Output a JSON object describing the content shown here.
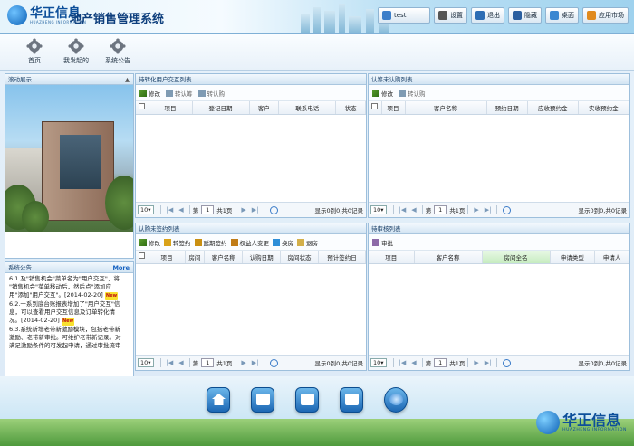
{
  "header": {
    "logo_cn": "华正信息",
    "logo_en": "HUAZHENG INFORMATION",
    "title": "地产销售管理系统",
    "buttons": [
      {
        "label": "test",
        "icon": "user-icon"
      },
      {
        "label": "设置",
        "icon": "settings-icon"
      },
      {
        "label": "退出",
        "icon": "logout-icon"
      },
      {
        "label": "隐藏",
        "icon": "hide-icon"
      },
      {
        "label": "桌面",
        "icon": "desktop-icon"
      },
      {
        "label": "应用市场",
        "icon": "app-market-icon"
      }
    ]
  },
  "topnav": [
    "首页",
    "我发起的",
    "系统公告"
  ],
  "left": {
    "photo_title": "滚动展示",
    "ann_title": "系统公告",
    "ann_more": "More",
    "ann_lines": [
      "6.1.及\"销售机会\"菜单名为\"用户交互\"，将",
      "\"销售机会\"菜单移动后，然后点\"添加应",
      "用\"添加\"用户交互\"。[2014-02-20]",
      "6.2.一系到底台账报表增加了\"用户交互\"信",
      "息，可以查看用户交互信息及订单转化情",
      "况。[2014-02-20]",
      "6.3.系统新增老带新激励模块，包括老带新",
      "激励、老带新审批。可维护老带新记录。对",
      "满足激励条件的可发起申请，通过审批流审"
    ],
    "new_badge": "New"
  },
  "panels": {
    "p1": {
      "title": "待转化用户交互列表",
      "tools": [
        "修改",
        "转认筹",
        "转认购"
      ],
      "cols": [
        "项目",
        "登记日期",
        "客户",
        "联系电话",
        "状态"
      ]
    },
    "p2": {
      "title": "认筹未认购列表",
      "tools": [
        "修改",
        "转认购"
      ],
      "cols": [
        "项目",
        "客户名称",
        "预约日期",
        "应收预约金",
        "实收预约金"
      ]
    },
    "p3": {
      "title": "认购未签约列表",
      "tools": [
        "修改",
        "转签约",
        "延期签约",
        "权益人变更",
        "换房",
        "退房"
      ],
      "cols": [
        "项目",
        "房间",
        "客户名称",
        "认购日期",
        "房间状态",
        "预计签约日"
      ]
    },
    "p4": {
      "title": "待审核列表",
      "tools": [
        "审批"
      ],
      "cols": [
        "项目",
        "客户名称",
        "房间全名",
        "申请类型",
        "申请人"
      ]
    }
  },
  "pager": {
    "size": "10",
    "page": "1",
    "pages": "共1页",
    "info": "显示0到0,共0记录"
  },
  "colors": {
    "accent": "#1c67b4",
    "header_bg": "#cde8f7",
    "panel_border": "#9dbfdc"
  }
}
